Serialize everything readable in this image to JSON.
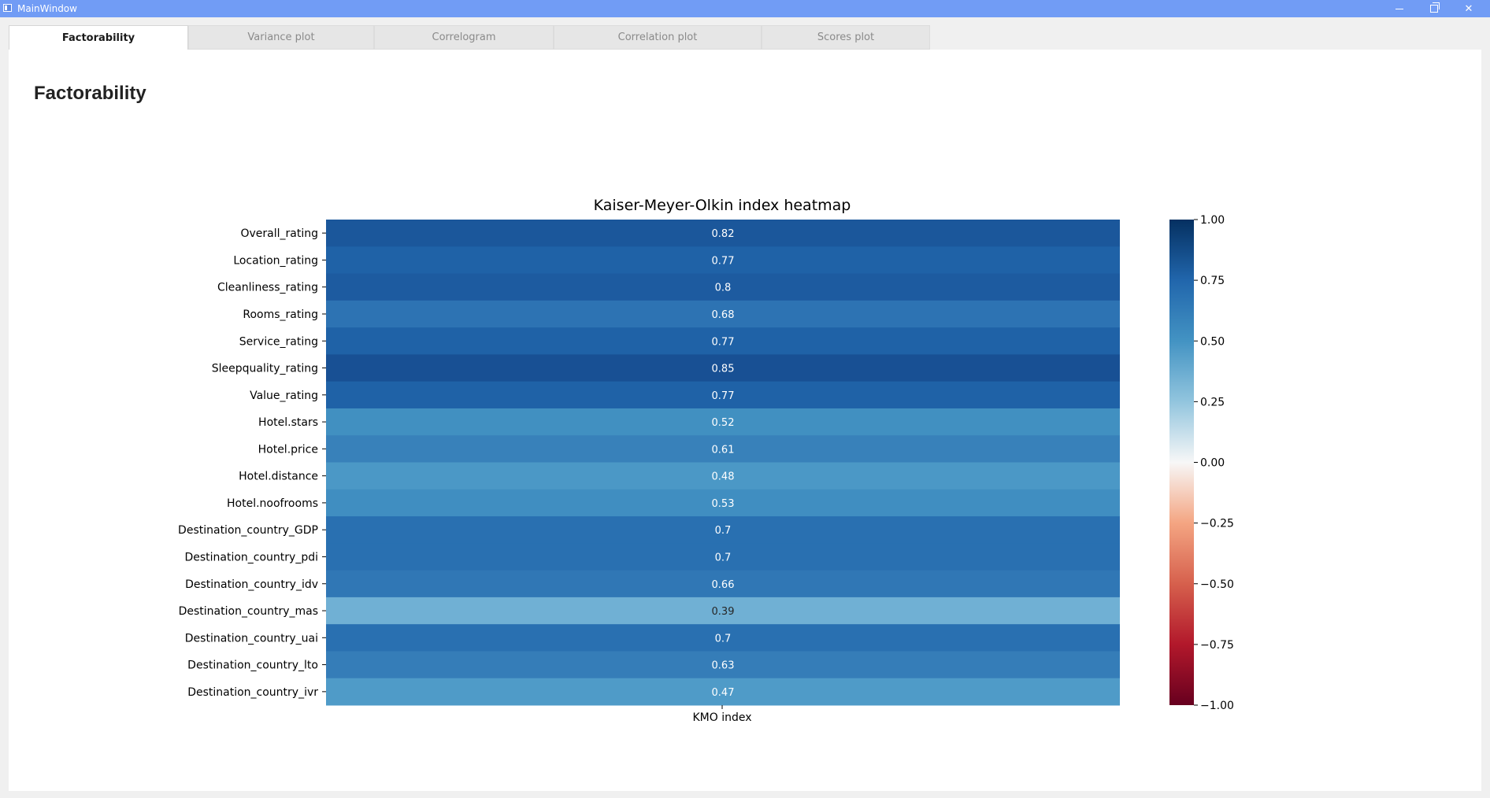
{
  "window": {
    "title": "MainWindow",
    "minimize_icon": "minimize-icon",
    "restore_icon": "restore-icon",
    "close_icon": "close-icon"
  },
  "tabs": [
    {
      "label": "Factorability",
      "active": true
    },
    {
      "label": "Variance plot",
      "active": false
    },
    {
      "label": "Correlogram",
      "active": false
    },
    {
      "label": "Correlation plot",
      "active": false
    },
    {
      "label": "Scores plot",
      "active": false
    }
  ],
  "page": {
    "title": "Factorability"
  },
  "chart_data": {
    "type": "heatmap",
    "title": "Kaiser-Meyer-Olkin index heatmap",
    "xlabel": "",
    "ylabel": "",
    "columns": [
      "KMO index"
    ],
    "rows": [
      "Overall_rating",
      "Location_rating",
      "Cleanliness_rating",
      "Rooms_rating",
      "Service_rating",
      "Sleepquality_rating",
      "Value_rating",
      "Hotel.stars",
      "Hotel.price",
      "Hotel.distance",
      "Hotel.noofrooms",
      "Destination_country_GDP",
      "Destination_country_pdi",
      "Destination_country_idv",
      "Destination_country_mas",
      "Destination_country_uai",
      "Destination_country_lto",
      "Destination_country_ivr"
    ],
    "values": [
      0.82,
      0.77,
      0.8,
      0.68,
      0.77,
      0.85,
      0.77,
      0.52,
      0.61,
      0.48,
      0.53,
      0.7,
      0.7,
      0.66,
      0.39,
      0.7,
      0.63,
      0.47
    ],
    "annotations": [
      "0.82",
      "0.77",
      "0.8",
      "0.68",
      "0.77",
      "0.85",
      "0.77",
      "0.52",
      "0.61",
      "0.48",
      "0.53",
      "0.7",
      "0.7",
      "0.66",
      "0.39",
      "0.7",
      "0.63",
      "0.47"
    ],
    "colormap": "RdBu",
    "vmin": -1,
    "vmax": 1,
    "colorbar_ticks": [
      1.0,
      0.75,
      0.5,
      0.25,
      0.0,
      -0.25,
      -0.5,
      -0.75,
      -1.0
    ],
    "colorbar_tick_labels": [
      "1.00",
      "0.75",
      "0.50",
      "0.25",
      "0.00",
      "−0.25",
      "−0.50",
      "−0.75",
      "−1.00"
    ],
    "colorbar_placement": "right"
  }
}
